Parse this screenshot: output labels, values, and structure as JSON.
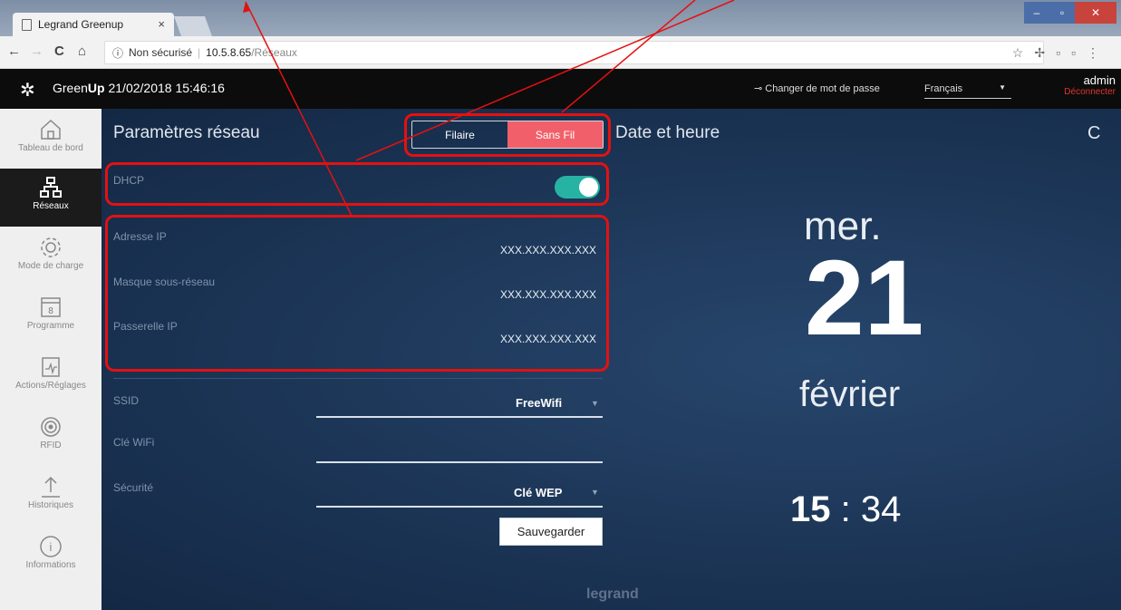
{
  "browser": {
    "tab_title": "Legrand Greenup",
    "tab_close": "×",
    "addr_info": "ⓘ",
    "addr_security": "Non sécurisé",
    "addr_sep": "|",
    "addr_host": "10.5.8.65",
    "addr_path": "/Réseaux",
    "back": "←",
    "forward": "→",
    "reload": "C",
    "home": "⌂"
  },
  "header": {
    "brand_prefix": "Green",
    "brand_bold": "Up",
    "datetime": "21/02/2018 15:46:16",
    "change_password": "Changer de mot de passe",
    "language": "Français",
    "user": "admin",
    "logout": "Déconnecter"
  },
  "sidebar": {
    "items": [
      {
        "label": "Tableau de bord",
        "icon": "home-icon"
      },
      {
        "label": "Réseaux",
        "icon": "network-icon"
      },
      {
        "label": "Mode de charge",
        "icon": "gear-icon"
      },
      {
        "label": "Programme",
        "icon": "calendar-icon"
      },
      {
        "label": "Actions/Réglages",
        "icon": "clipboard-icon"
      },
      {
        "label": "RFID",
        "icon": "rfid-icon"
      },
      {
        "label": "Historiques",
        "icon": "upload-icon"
      },
      {
        "label": "Informations",
        "icon": "info-icon"
      }
    ],
    "calendar_day": "8",
    "info_glyph": "i"
  },
  "network": {
    "title": "Paramètres réseau",
    "tab_wired": "Filaire",
    "tab_wireless": "Sans Fil",
    "dhcp_label": "DHCP",
    "ip_label": "Adresse IP",
    "ip_value": "XXX.XXX.XXX.XXX",
    "mask_label": "Masque sous-réseau",
    "mask_value": "XXX.XXX.XXX.XXX",
    "gateway_label": "Passerelle IP",
    "gateway_value": "XXX.XXX.XXX.XXX",
    "ssid_label": "SSID",
    "ssid_value": "FreeWifi",
    "wifi_key_label": "Clé WiFi",
    "wifi_key_value": "",
    "security_label": "Sécurité",
    "security_value": "Clé WEP",
    "save_label": "Sauvegarder"
  },
  "datetime_panel": {
    "title": "Date et heure",
    "refresh_glyph": "C",
    "day_of_week": "mer.",
    "day": "21",
    "month": "février",
    "hours": "15",
    "time_sep": ":",
    "minutes": "34"
  },
  "footer": {
    "brand": "legrand"
  },
  "colors": {
    "accent": "#f1606a",
    "toggle_on": "#27b3a3",
    "annotation": "#e41111",
    "panel_bg": "#1c3556"
  }
}
